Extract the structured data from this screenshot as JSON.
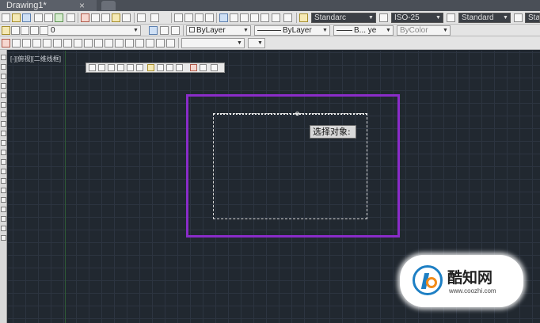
{
  "tabs": {
    "document": "Drawing1*",
    "close": "×"
  },
  "toolbar": {
    "text_style": "Standarc",
    "dim_style": "ISO-25",
    "table_style": "Standard",
    "multileader_style": "Star",
    "layer": "0",
    "color": "ByLayer",
    "linetype": "ByLayer",
    "lineweight": "B... ye",
    "plot_style": "ByColor"
  },
  "viewport": {
    "label": "[-][俯视][二维线框]"
  },
  "canvas": {
    "prompt_tooltip": "选择对象:"
  },
  "watermark": {
    "brand": "酷知网",
    "url": "www.coozhi.com"
  },
  "colors": {
    "rectangle": "#8a2cc9",
    "background": "#212830",
    "selection": "#d8d8d8"
  }
}
